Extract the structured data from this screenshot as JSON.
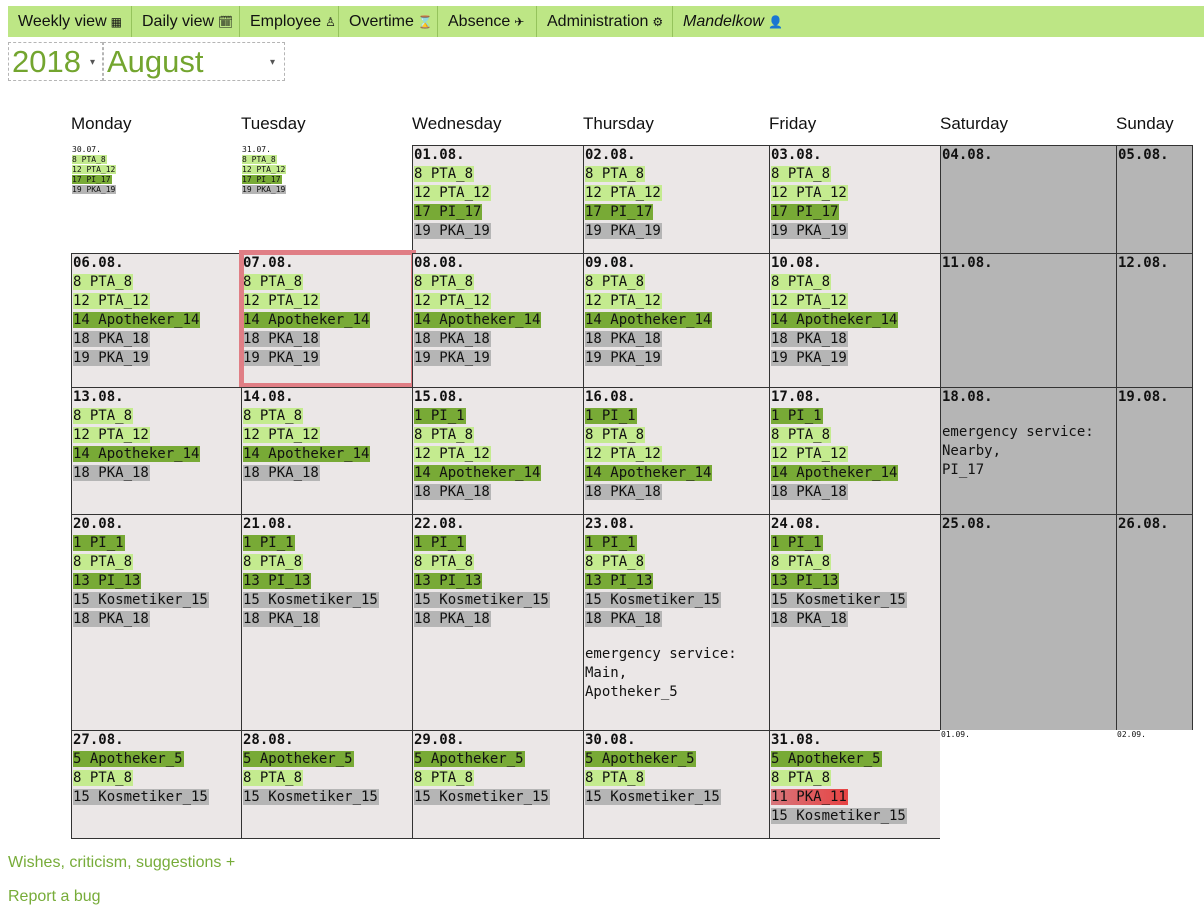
{
  "nav": {
    "items": [
      {
        "label": "Weekly view",
        "icon": "calendar-grid-icon",
        "glyph": "▦"
      },
      {
        "label": "Daily view",
        "icon": "calendar-day-icon",
        "glyph": "🗓"
      },
      {
        "label": "Employee",
        "icon": "person-icon",
        "glyph": "♙"
      },
      {
        "label": "Overtime",
        "icon": "hourglass-icon",
        "glyph": "⌛"
      },
      {
        "label": "Absence",
        "icon": "plane-icon",
        "glyph": "✈"
      },
      {
        "label": "Administration",
        "icon": "gear-icon",
        "glyph": "⚙"
      }
    ],
    "user": {
      "label": "Mandelkow",
      "icon": "user-icon",
      "glyph": "👤"
    }
  },
  "year_select": {
    "value": "2018",
    "arrow": "▾"
  },
  "month_select": {
    "value": "August",
    "arrow": "▾"
  },
  "day_names": [
    "Monday",
    "Tuesday",
    "Wednesday",
    "Thursday",
    "Friday",
    "Saturday",
    "Sunday"
  ],
  "colors": {
    "light": "#c4eb8f",
    "dark": "#78aa36",
    "gray": "#b5b5b5",
    "red": "#e74343",
    "selected_border": "#e07e85"
  },
  "weeks": [
    {
      "days": [
        {
          "date": "30.07.",
          "outside": true,
          "entries": [
            {
              "text": "8 PTA_8",
              "c": "light"
            },
            {
              "text": "12 PTA_12",
              "c": "light"
            },
            {
              "text": "17 PI_17",
              "c": "dark"
            },
            {
              "text": "19 PKA_19",
              "c": "gray"
            }
          ]
        },
        {
          "date": "31.07.",
          "outside": true,
          "entries": [
            {
              "text": "8 PTA_8",
              "c": "light"
            },
            {
              "text": "12 PTA_12",
              "c": "light"
            },
            {
              "text": "17 PI_17",
              "c": "dark"
            },
            {
              "text": "19 PKA_19",
              "c": "gray"
            }
          ]
        },
        {
          "date": "01.08.",
          "entries": [
            {
              "text": "8 PTA_8",
              "c": "light"
            },
            {
              "text": "12 PTA_12",
              "c": "light"
            },
            {
              "text": "17 PI_17",
              "c": "dark"
            },
            {
              "text": "19 PKA_19",
              "c": "gray"
            }
          ]
        },
        {
          "date": "02.08.",
          "entries": [
            {
              "text": "8 PTA_8",
              "c": "light"
            },
            {
              "text": "12 PTA_12",
              "c": "light"
            },
            {
              "text": "17 PI_17",
              "c": "dark"
            },
            {
              "text": "19 PKA_19",
              "c": "gray"
            }
          ]
        },
        {
          "date": "03.08.",
          "entries": [
            {
              "text": "8 PTA_8",
              "c": "light"
            },
            {
              "text": "12 PTA_12",
              "c": "light"
            },
            {
              "text": "17 PI_17",
              "c": "dark"
            },
            {
              "text": "19 PKA_19",
              "c": "gray"
            }
          ]
        },
        {
          "date": "04.08.",
          "weekend": true,
          "entries": []
        },
        {
          "date": "05.08.",
          "weekend": true,
          "entries": []
        }
      ]
    },
    {
      "days": [
        {
          "date": "06.08.",
          "entries": [
            {
              "text": "8 PTA_8",
              "c": "light"
            },
            {
              "text": "12 PTA_12",
              "c": "light"
            },
            {
              "text": "14 Apotheker_14",
              "c": "dark"
            },
            {
              "text": "18 PKA_18",
              "c": "gray"
            },
            {
              "text": "19 PKA_19",
              "c": "gray"
            }
          ]
        },
        {
          "date": "07.08.",
          "selected": true,
          "entries": [
            {
              "text": "8 PTA_8",
              "c": "light"
            },
            {
              "text": "12 PTA_12",
              "c": "light"
            },
            {
              "text": "14 Apotheker_14",
              "c": "dark"
            },
            {
              "text": "18 PKA_18",
              "c": "gray"
            },
            {
              "text": "19 PKA_19",
              "c": "gray"
            }
          ]
        },
        {
          "date": "08.08.",
          "entries": [
            {
              "text": "8 PTA_8",
              "c": "light"
            },
            {
              "text": "12 PTA_12",
              "c": "light"
            },
            {
              "text": "14 Apotheker_14",
              "c": "dark"
            },
            {
              "text": "18 PKA_18",
              "c": "gray"
            },
            {
              "text": "19 PKA_19",
              "c": "gray"
            }
          ]
        },
        {
          "date": "09.08.",
          "entries": [
            {
              "text": "8 PTA_8",
              "c": "light"
            },
            {
              "text": "12 PTA_12",
              "c": "light"
            },
            {
              "text": "14 Apotheker_14",
              "c": "dark"
            },
            {
              "text": "18 PKA_18",
              "c": "gray"
            },
            {
              "text": "19 PKA_19",
              "c": "gray"
            }
          ]
        },
        {
          "date": "10.08.",
          "entries": [
            {
              "text": "8 PTA_8",
              "c": "light"
            },
            {
              "text": "12 PTA_12",
              "c": "light"
            },
            {
              "text": "14 Apotheker_14",
              "c": "dark"
            },
            {
              "text": "18 PKA_18",
              "c": "gray"
            },
            {
              "text": "19 PKA_19",
              "c": "gray"
            }
          ]
        },
        {
          "date": "11.08.",
          "weekend": true,
          "entries": []
        },
        {
          "date": "12.08.",
          "weekend": true,
          "entries": []
        }
      ]
    },
    {
      "days": [
        {
          "date": "13.08.",
          "entries": [
            {
              "text": "8 PTA_8",
              "c": "light"
            },
            {
              "text": "12 PTA_12",
              "c": "light"
            },
            {
              "text": "14 Apotheker_14",
              "c": "dark"
            },
            {
              "text": "18 PKA_18",
              "c": "gray"
            }
          ]
        },
        {
          "date": "14.08.",
          "entries": [
            {
              "text": "8 PTA_8",
              "c": "light"
            },
            {
              "text": "12 PTA_12",
              "c": "light"
            },
            {
              "text": "14 Apotheker_14",
              "c": "dark"
            },
            {
              "text": "18 PKA_18",
              "c": "gray"
            }
          ]
        },
        {
          "date": "15.08.",
          "entries": [
            {
              "text": "1 PI_1",
              "c": "dark"
            },
            {
              "text": "8 PTA_8",
              "c": "light"
            },
            {
              "text": "12 PTA_12",
              "c": "light"
            },
            {
              "text": "14 Apotheker_14",
              "c": "dark"
            },
            {
              "text": "18 PKA_18",
              "c": "gray"
            }
          ]
        },
        {
          "date": "16.08.",
          "entries": [
            {
              "text": "1 PI_1",
              "c": "dark"
            },
            {
              "text": "8 PTA_8",
              "c": "light"
            },
            {
              "text": "12 PTA_12",
              "c": "light"
            },
            {
              "text": "14 Apotheker_14",
              "c": "dark"
            },
            {
              "text": "18 PKA_18",
              "c": "gray"
            }
          ]
        },
        {
          "date": "17.08.",
          "entries": [
            {
              "text": "1 PI_1",
              "c": "dark"
            },
            {
              "text": "8 PTA_8",
              "c": "light"
            },
            {
              "text": "12 PTA_12",
              "c": "light"
            },
            {
              "text": "14 Apotheker_14",
              "c": "dark"
            },
            {
              "text": "18 PKA_18",
              "c": "gray"
            }
          ]
        },
        {
          "date": "18.08.",
          "weekend": true,
          "entries": [],
          "note": "emergency service:\nNearby,\nPI_17"
        },
        {
          "date": "19.08.",
          "weekend": true,
          "entries": []
        }
      ]
    },
    {
      "days": [
        {
          "date": "20.08.",
          "entries": [
            {
              "text": "1 PI_1",
              "c": "dark"
            },
            {
              "text": "8 PTA_8",
              "c": "light"
            },
            {
              "text": "13 PI_13",
              "c": "dark"
            },
            {
              "text": "15 Kosmetiker_15",
              "c": "gray"
            },
            {
              "text": "18 PKA_18",
              "c": "gray"
            }
          ]
        },
        {
          "date": "21.08.",
          "entries": [
            {
              "text": "1 PI_1",
              "c": "dark"
            },
            {
              "text": "8 PTA_8",
              "c": "light"
            },
            {
              "text": "13 PI_13",
              "c": "dark"
            },
            {
              "text": "15 Kosmetiker_15",
              "c": "gray"
            },
            {
              "text": "18 PKA_18",
              "c": "gray"
            }
          ]
        },
        {
          "date": "22.08.",
          "entries": [
            {
              "text": "1 PI_1",
              "c": "dark"
            },
            {
              "text": "8 PTA_8",
              "c": "light"
            },
            {
              "text": "13 PI_13",
              "c": "dark"
            },
            {
              "text": "15 Kosmetiker_15",
              "c": "gray"
            },
            {
              "text": "18 PKA_18",
              "c": "gray"
            }
          ]
        },
        {
          "date": "23.08.",
          "entries": [
            {
              "text": "1 PI_1",
              "c": "dark"
            },
            {
              "text": "8 PTA_8",
              "c": "light"
            },
            {
              "text": "13 PI_13",
              "c": "dark"
            },
            {
              "text": "15 Kosmetiker_15",
              "c": "gray"
            },
            {
              "text": "18 PKA_18",
              "c": "gray"
            }
          ],
          "note": "emergency service:\nMain,\nApotheker_5"
        },
        {
          "date": "24.08.",
          "entries": [
            {
              "text": "1 PI_1",
              "c": "dark"
            },
            {
              "text": "8 PTA_8",
              "c": "light"
            },
            {
              "text": "13 PI_13",
              "c": "dark"
            },
            {
              "text": "15 Kosmetiker_15",
              "c": "gray"
            },
            {
              "text": "18 PKA_18",
              "c": "gray"
            }
          ]
        },
        {
          "date": "25.08.",
          "weekend": true,
          "entries": []
        },
        {
          "date": "26.08.",
          "weekend": true,
          "entries": []
        }
      ]
    },
    {
      "days": [
        {
          "date": "27.08.",
          "entries": [
            {
              "text": "5 Apotheker_5",
              "c": "dark"
            },
            {
              "text": "8 PTA_8",
              "c": "light"
            },
            {
              "text": "15 Kosmetiker_15",
              "c": "gray"
            }
          ]
        },
        {
          "date": "28.08.",
          "entries": [
            {
              "text": "5 Apotheker_5",
              "c": "dark"
            },
            {
              "text": "8 PTA_8",
              "c": "light"
            },
            {
              "text": "15 Kosmetiker_15",
              "c": "gray"
            }
          ]
        },
        {
          "date": "29.08.",
          "entries": [
            {
              "text": "5 Apotheker_5",
              "c": "dark"
            },
            {
              "text": "8 PTA_8",
              "c": "light"
            },
            {
              "text": "15 Kosmetiker_15",
              "c": "gray"
            }
          ]
        },
        {
          "date": "30.08.",
          "entries": [
            {
              "text": "5 Apotheker_5",
              "c": "dark"
            },
            {
              "text": "8 PTA_8",
              "c": "light"
            },
            {
              "text": "15 Kosmetiker_15",
              "c": "gray"
            }
          ]
        },
        {
          "date": "31.08.",
          "entries": [
            {
              "text": "5 Apotheker_5",
              "c": "dark"
            },
            {
              "text": "8 PTA_8",
              "c": "light"
            },
            {
              "text": "11 PKA_11",
              "c": "red"
            },
            {
              "text": "15 Kosmetiker_15",
              "c": "gray"
            }
          ]
        },
        {
          "date": "01.09.",
          "outside": true,
          "entries": []
        },
        {
          "date": "02.09.",
          "outside": true,
          "entries": []
        }
      ]
    }
  ],
  "footer": {
    "feedback_link": "Wishes, criticism, suggestions +",
    "bug_link": "Report a bug"
  }
}
